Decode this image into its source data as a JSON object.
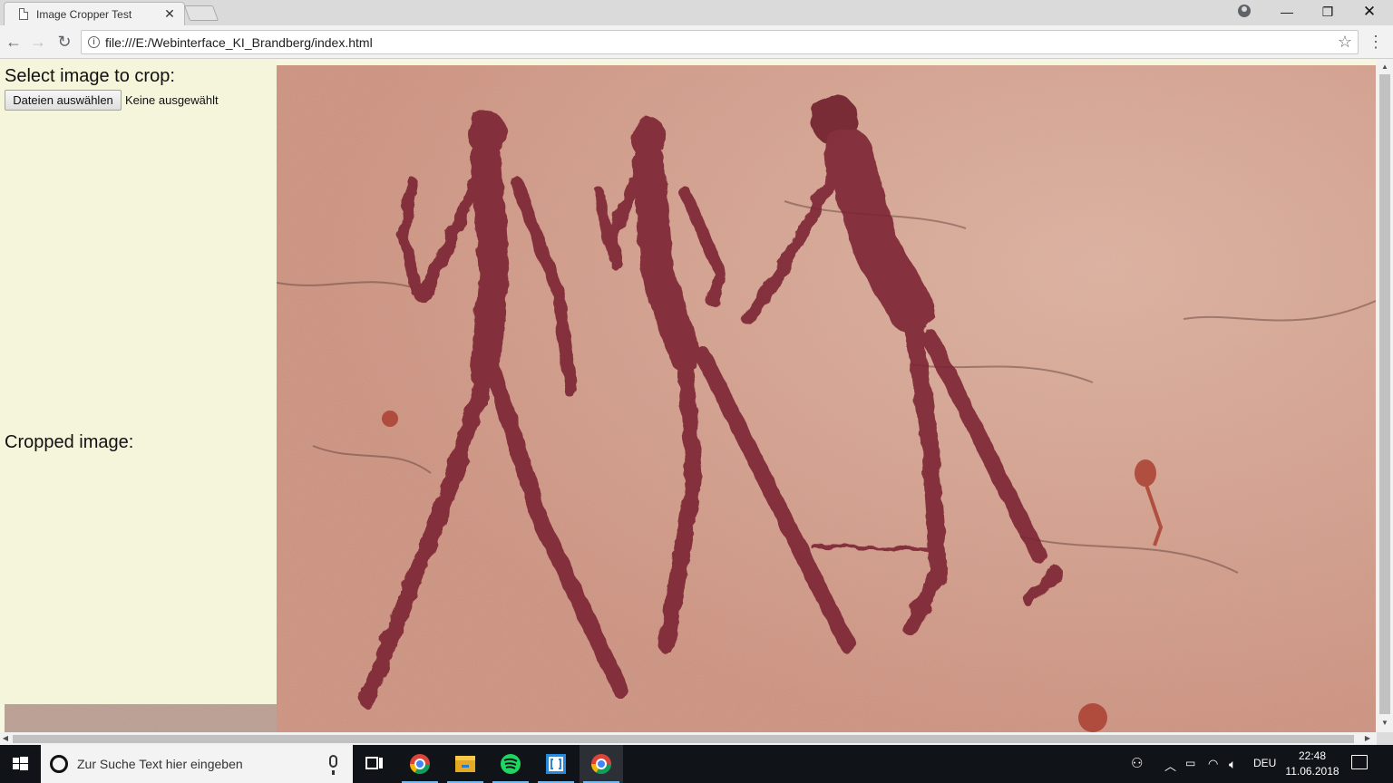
{
  "browser": {
    "tab_title": "Image Cropper Test",
    "url": "file:///E:/Webinterface_KI_Brandberg/index.html",
    "icons": [
      "page-icon",
      "close-icon",
      "profile-icon",
      "minimize-icon",
      "restore-icon",
      "window-close-icon",
      "back-icon",
      "forward-icon",
      "reload-icon",
      "info-icon",
      "star-icon",
      "menu-icon"
    ]
  },
  "page": {
    "select_heading": "Select image to crop:",
    "file_button": "Dateien auswählen",
    "file_status": "Keine ausgewählt",
    "cropped_heading": "Cropped image:",
    "colors": {
      "panel": "#f5f5dc",
      "rock": "#d99880",
      "figure": "#7a2230"
    }
  },
  "taskbar": {
    "search_placeholder": "Zur Suche Text hier eingeben",
    "apps": [
      "task-view",
      "chrome",
      "file-explorer",
      "spotify",
      "bracket-app",
      "chrome"
    ],
    "language": "DEU",
    "time": "22:48",
    "date": "11.06.2018"
  }
}
